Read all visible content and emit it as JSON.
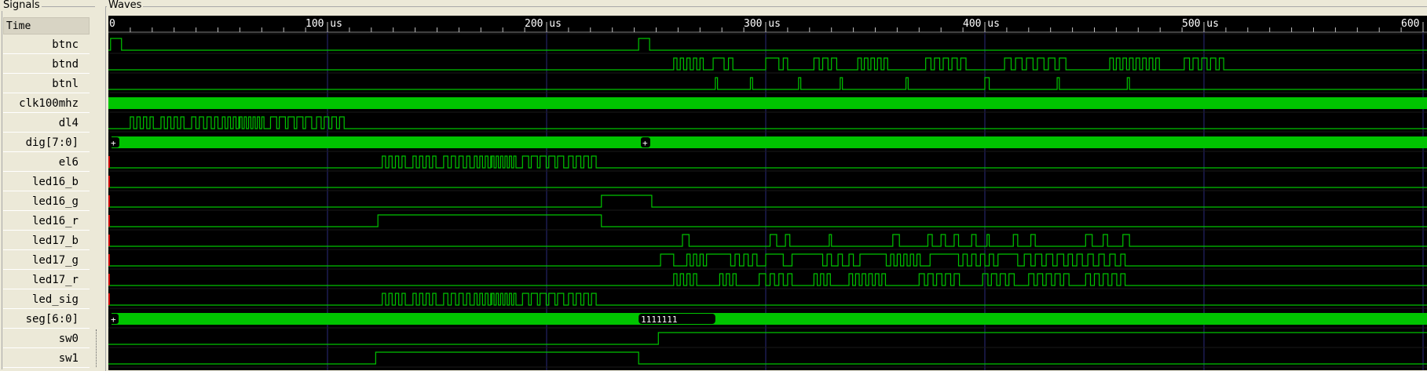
{
  "panels": {
    "signals_title": "Signals",
    "waves_title": "Waves",
    "time_header": "Time"
  },
  "signals": [
    {
      "name": "btnc"
    },
    {
      "name": "btnd"
    },
    {
      "name": "btnl"
    },
    {
      "name": "clk100mhz"
    },
    {
      "name": "dl4"
    },
    {
      "name": "dig[7:0]"
    },
    {
      "name": "el6"
    },
    {
      "name": "led16_b"
    },
    {
      "name": "led16_g"
    },
    {
      "name": "led16_r"
    },
    {
      "name": "led17_b"
    },
    {
      "name": "led17_g"
    },
    {
      "name": "led17_r"
    },
    {
      "name": "led_sig"
    },
    {
      "name": "seg[6:0]"
    },
    {
      "name": "sw0"
    },
    {
      "name": "sw1"
    }
  ],
  "time_axis": {
    "unit": "us",
    "start_label": "0",
    "ticks": [
      {
        "value": 100,
        "label": "100 us"
      },
      {
        "value": 200,
        "label": "200 us"
      },
      {
        "value": 300,
        "label": "300 us"
      },
      {
        "value": 400,
        "label": "400 us"
      },
      {
        "value": 500,
        "label": "500 us"
      },
      {
        "value": 600,
        "label": "600"
      }
    ],
    "view_end_us": 600
  },
  "bus_values": {
    "dig_marker_1": "+",
    "dig_marker_2": "+",
    "seg_marker_1": "+",
    "seg_value": "1111111"
  },
  "colors": {
    "wave": "#00c400",
    "background": "#000000",
    "grid": "#2a2a7a",
    "undefined": "#cc0000",
    "panel": "#ece9d8"
  }
}
